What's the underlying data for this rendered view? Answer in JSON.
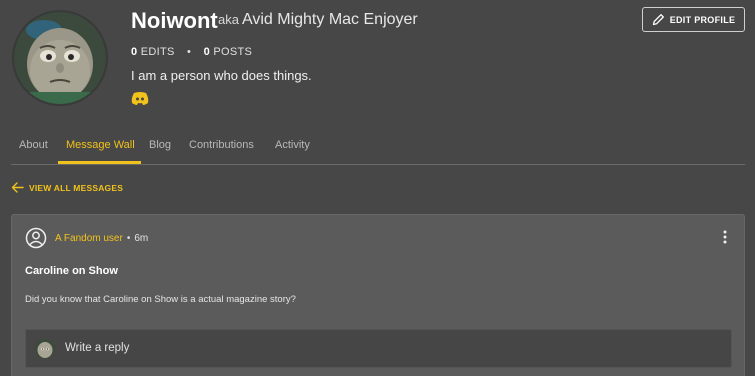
{
  "profile": {
    "username": "Noiwont",
    "aka_word": "aka",
    "aka_name": "Avid Mighty Mac Enjoyer",
    "edits_count": "0",
    "edits_label": "EDITS",
    "separator": "•",
    "posts_count": "0",
    "posts_label": "POSTS",
    "bio": "I am a person who does things.",
    "edit_button_label": "EDIT PROFILE"
  },
  "tabs": [
    {
      "label": "About"
    },
    {
      "label": "Message Wall"
    },
    {
      "label": "Blog"
    },
    {
      "label": "Contributions"
    },
    {
      "label": "Activity"
    }
  ],
  "active_tab": "Message Wall",
  "view_all_label": "VIEW ALL MESSAGES",
  "message": {
    "author": "A Fandom user",
    "separator": "•",
    "time": "6m",
    "title": "Caroline on Show",
    "body": "Did you know that Caroline on Show is a actual magazine story?",
    "reply_placeholder": "Write a reply"
  },
  "colors": {
    "background": "#474747",
    "accent": "#f1c21b",
    "card": "#5b5b5b",
    "discord": "#f1c21b"
  },
  "icons": [
    "avatar",
    "discord-icon",
    "pencil-icon",
    "arrow-left-icon",
    "user-circle-icon",
    "kebab-menu-icon"
  ]
}
